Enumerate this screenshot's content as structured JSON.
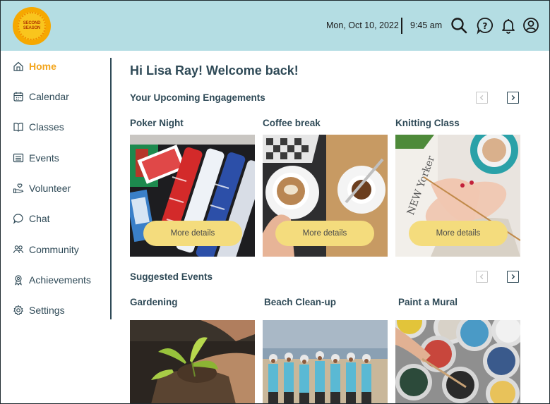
{
  "header": {
    "logo_text_1": "SECOND",
    "logo_text_2": "SEASON",
    "date": "Mon, Oct 10, 2022",
    "time": "9:45 am",
    "icons": [
      "search-icon",
      "help-icon",
      "bell-icon",
      "user-icon"
    ]
  },
  "sidebar": {
    "items": [
      {
        "label": "Home",
        "icon": "home-icon",
        "active": true
      },
      {
        "label": "Calendar",
        "icon": "calendar-icon"
      },
      {
        "label": "Classes",
        "icon": "book-icon"
      },
      {
        "label": "Events",
        "icon": "list-icon"
      },
      {
        "label": "Volunteer",
        "icon": "hand-heart-icon"
      },
      {
        "label": "Chat",
        "icon": "chat-icon"
      },
      {
        "label": "Community",
        "icon": "people-icon"
      },
      {
        "label": "Achievements",
        "icon": "award-icon"
      },
      {
        "label": "Settings",
        "icon": "gear-icon"
      }
    ]
  },
  "main": {
    "welcome": "Hi Lisa Ray! Welcome back!",
    "upcoming": {
      "title": "Your Upcoming Engagements",
      "cards": [
        {
          "title": "Poker Night",
          "button": "More details"
        },
        {
          "title": "Coffee break",
          "button": "More details"
        },
        {
          "title": "Knitting Class",
          "button": "More details"
        }
      ]
    },
    "suggested": {
      "title": "Suggested Events",
      "cards": [
        {
          "title": "Gardening"
        },
        {
          "title": "Beach Clean-up"
        },
        {
          "title": "Paint a Mural"
        }
      ]
    }
  },
  "colors": {
    "header_bg": "#b4dde3",
    "accent": "#f3a51c",
    "button": "#f4dc7d",
    "text": "#2f4a57"
  }
}
